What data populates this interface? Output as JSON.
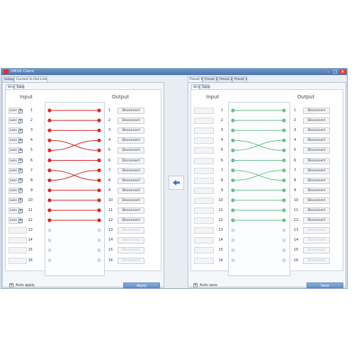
{
  "window": {
    "title": "VM16 Client"
  },
  "left": {
    "tabs": [
      "Setup",
      "Current In-Out Link"
    ],
    "active_tab": 1,
    "subtabs": [
      "Wire",
      "Table"
    ],
    "active_subtab": 0,
    "input_label": "Input",
    "output_label": "Output",
    "loss_label": "Loss",
    "disconnect_label": "Disconnect",
    "auto_label": "Auto apply",
    "button_label": "Apply",
    "wire_color": "#d62a2a",
    "links": [
      [
        1,
        1
      ],
      [
        2,
        2
      ],
      [
        3,
        3
      ],
      [
        4,
        5
      ],
      [
        5,
        4
      ],
      [
        6,
        6
      ],
      [
        7,
        8
      ],
      [
        8,
        7
      ],
      [
        9,
        9
      ],
      [
        10,
        10
      ],
      [
        11,
        11
      ],
      [
        12,
        12
      ]
    ]
  },
  "right": {
    "tabs": [
      "Preset 0",
      "Preset 1",
      "Preset 2",
      "Preset 3"
    ],
    "active_tab": 0,
    "subtabs": [
      "Wire",
      "Table"
    ],
    "active_subtab": 0,
    "input_label": "Input",
    "output_label": "Output",
    "disconnect_label": "Disconnect",
    "auto_label": "Auto save",
    "button_label": "Save",
    "wire_color": "#6cbf8d",
    "links": [
      [
        1,
        1
      ],
      [
        2,
        2
      ],
      [
        3,
        3
      ],
      [
        4,
        5
      ],
      [
        5,
        4
      ],
      [
        6,
        6
      ],
      [
        7,
        8
      ],
      [
        8,
        7
      ],
      [
        9,
        9
      ],
      [
        10,
        10
      ],
      [
        11,
        11
      ],
      [
        12,
        12
      ]
    ]
  },
  "rows": [
    "1",
    "2",
    "3",
    "4",
    "5",
    "6",
    "7",
    "8",
    "9",
    "10",
    "11",
    "12",
    "13",
    "14",
    "15",
    "16"
  ],
  "connected_count": 12,
  "colors": {
    "inactive_dot": "#d4d7db",
    "accent": "#6190cc"
  }
}
